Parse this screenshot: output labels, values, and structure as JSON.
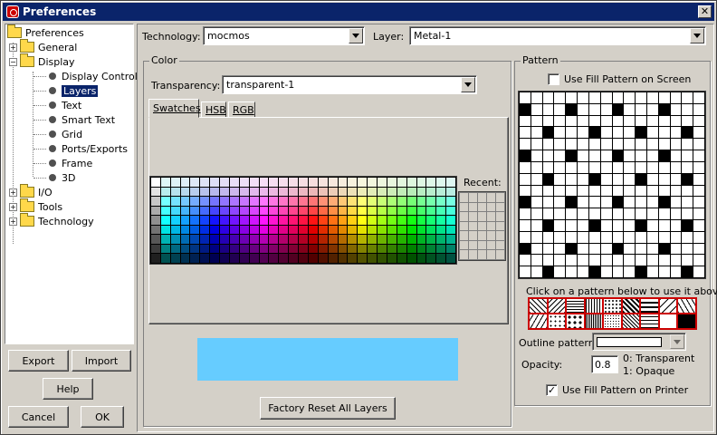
{
  "window": {
    "title": "Preferences",
    "close_glyph": "✕"
  },
  "tree": {
    "root": "Preferences",
    "general": "General",
    "display": "Display",
    "display_children": [
      "Display Control",
      "Layers",
      "Text",
      "Smart Text",
      "Grid",
      "Ports/Exports",
      "Frame",
      "3D"
    ],
    "io": "I/O",
    "tools": "Tools",
    "technology": "Technology",
    "selected": "Layers"
  },
  "buttons": {
    "export": "Export",
    "import": "Import",
    "help": "Help",
    "cancel": "Cancel",
    "ok": "OK",
    "factory_reset": "Factory Reset All Layers"
  },
  "header": {
    "technology_label": "Technology:",
    "technology_value": "mocmos",
    "layer_label": "Layer:",
    "layer_value": "Metal-1"
  },
  "color": {
    "group_title": "Color",
    "transparency_label": "Transparency:",
    "transparency_value": "transparent-1",
    "tabs": [
      "Swatches",
      "HSB",
      "RGB"
    ],
    "active_tab": "Swatches",
    "recent_label": "Recent:",
    "preview_color": "#66ccff"
  },
  "pattern": {
    "group_title": "Pattern",
    "use_fill_screen": "Use Fill Pattern on Screen",
    "use_fill_screen_checked": false,
    "hint": "Click on a pattern below to use it above",
    "outline_label": "Outline pattern:",
    "opacity_label": "Opacity:",
    "opacity_value": "0.8",
    "opacity_help_1": "0: Transparent",
    "opacity_help_2": "1: Opaque",
    "use_fill_printer": "Use Fill Pattern on Printer",
    "use_fill_printer_checked": true
  }
}
